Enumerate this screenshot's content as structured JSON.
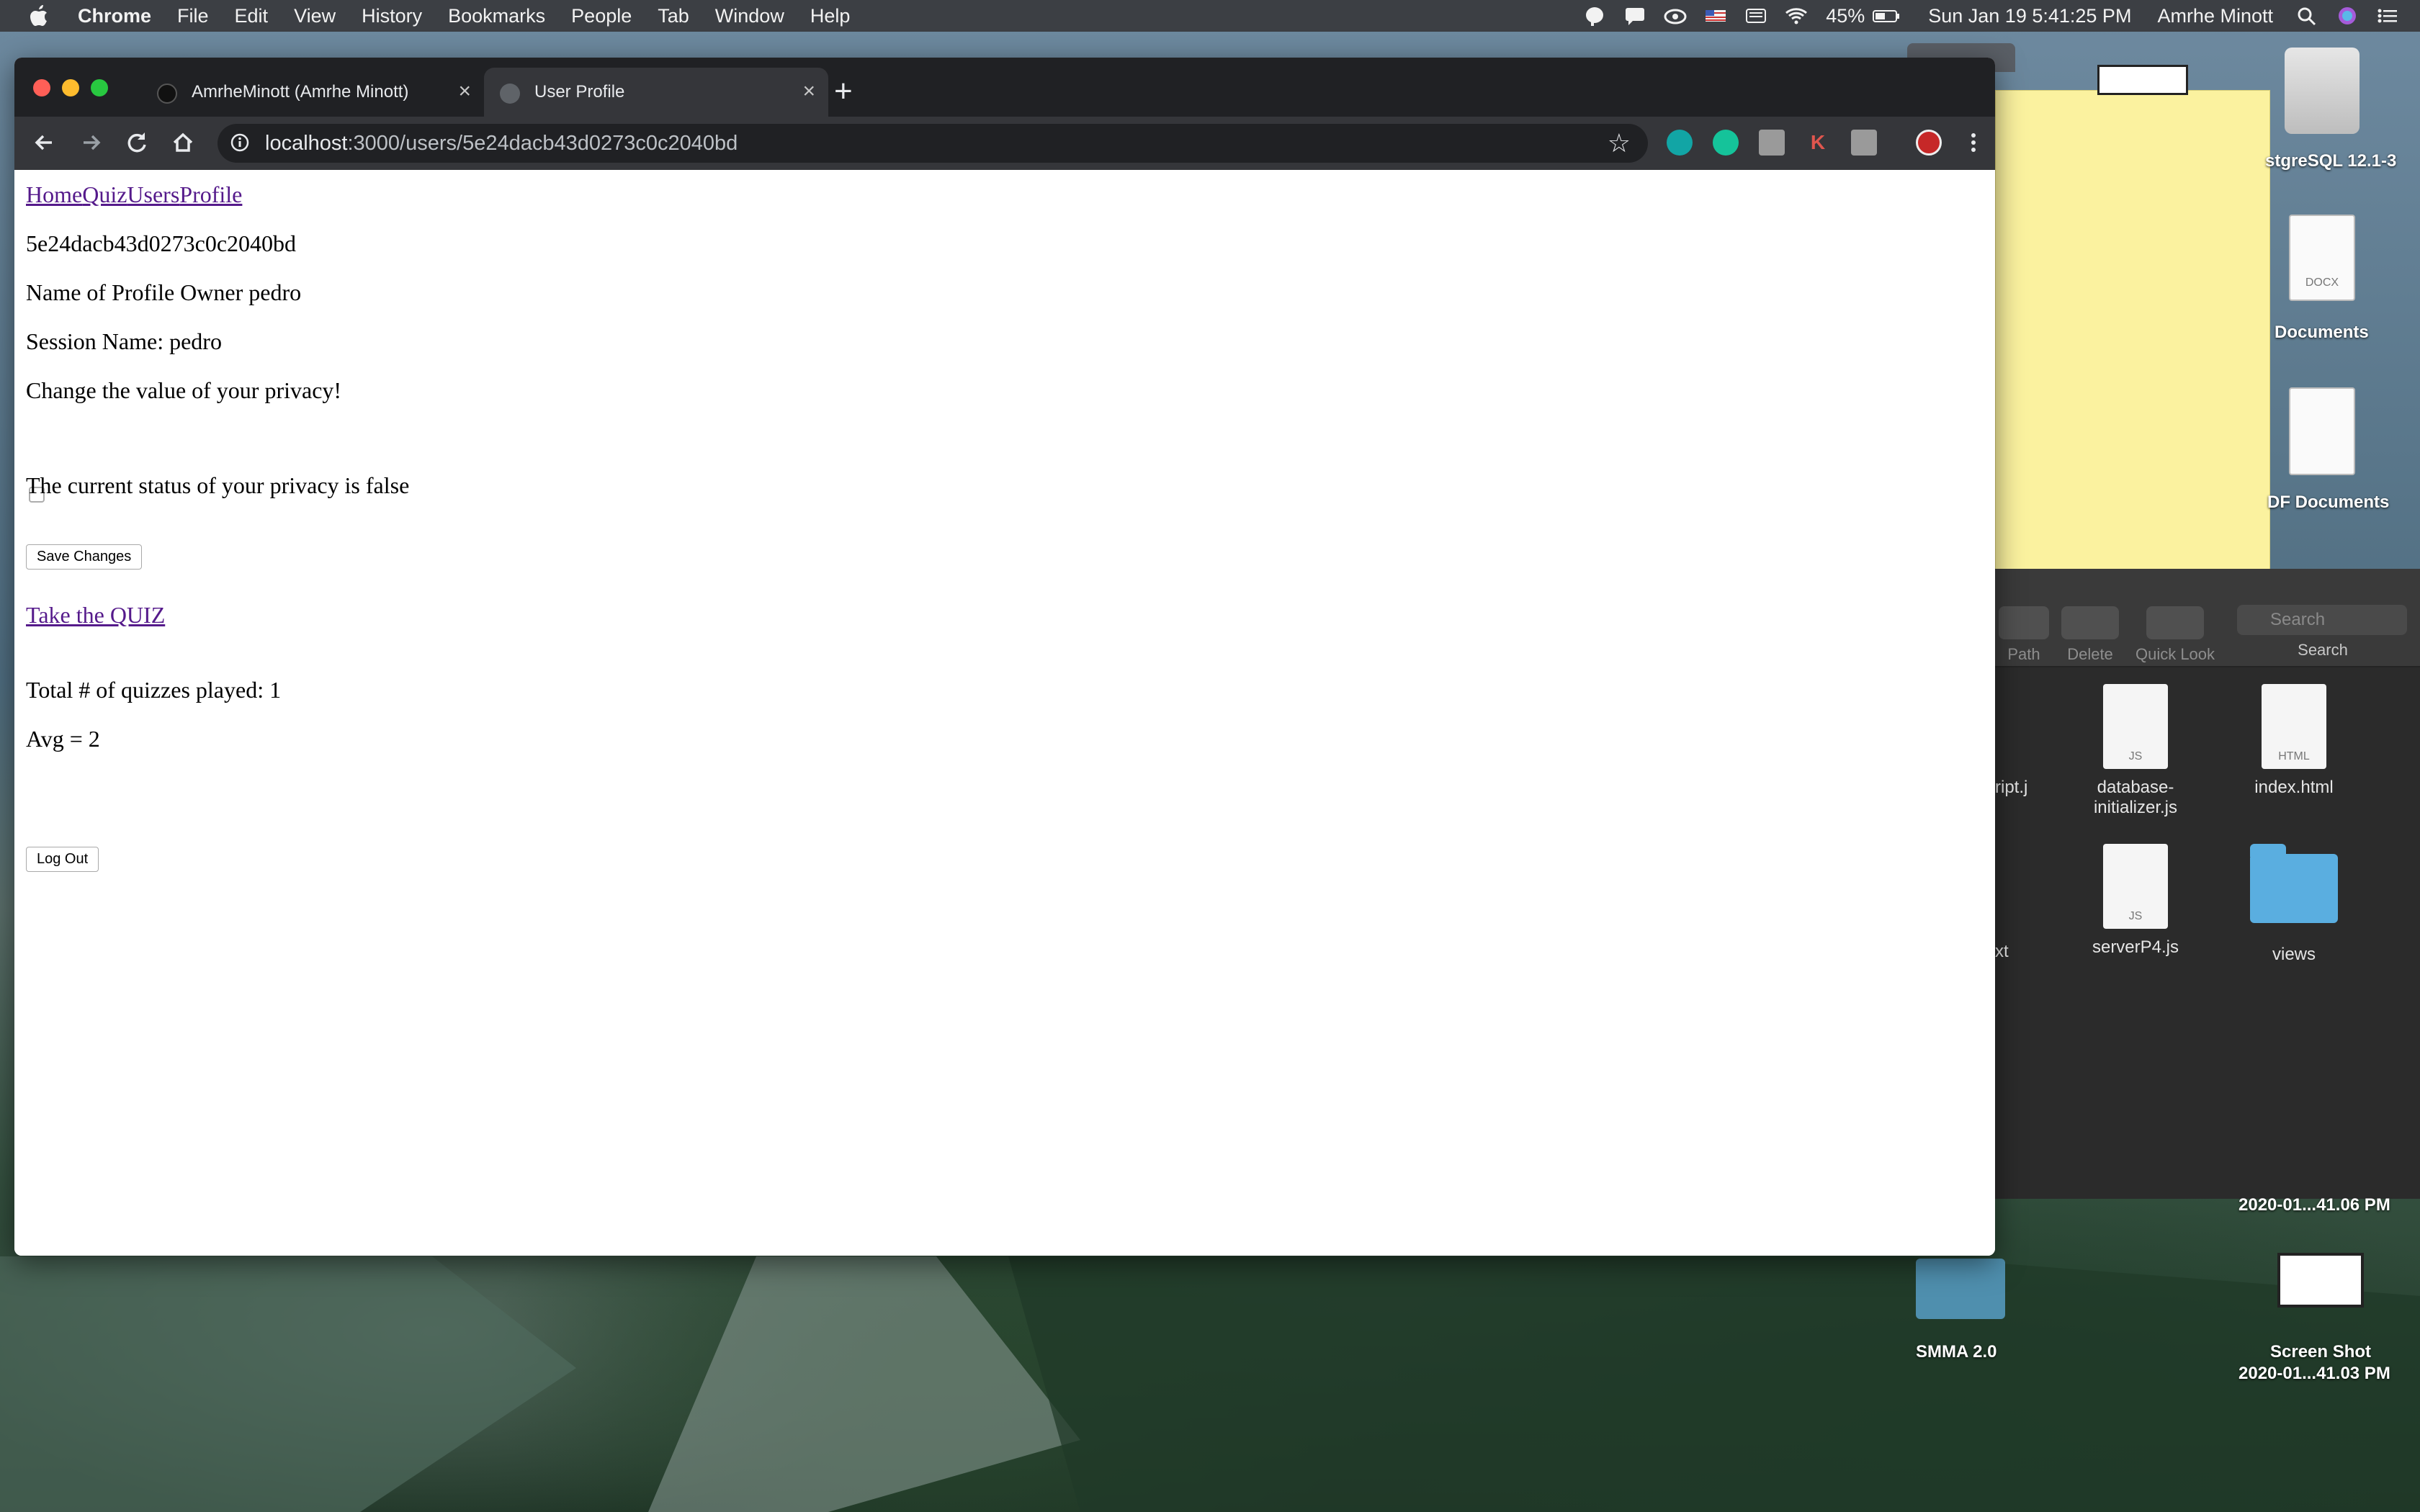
{
  "menubar": {
    "app_name": "Chrome",
    "menus": [
      "File",
      "Edit",
      "View",
      "History",
      "Bookmarks",
      "People",
      "Tab",
      "Window",
      "Help"
    ],
    "battery": "45%",
    "datetime": "Sun Jan 19  5:41:25 PM",
    "user": "Amrhe Minott"
  },
  "browser": {
    "tabs": [
      {
        "title": "AmrheMinott (Amrhe Minott)",
        "active": false
      },
      {
        "title": "User Profile",
        "active": true
      }
    ],
    "url_host": "localhost",
    "url_path": ":3000/users/5e24dacb43d0273c0c2040bd"
  },
  "page": {
    "nav_links": [
      "Home",
      "Quiz",
      "Users",
      "Profile"
    ],
    "user_id": "5e24dacb43d0273c0c2040bd",
    "profile_owner": "Name of Profile Owner pedro",
    "session_name": "Session Name: pedro",
    "privacy_prompt": "Change the value of your privacy!",
    "privacy_checked": false,
    "privacy_status": "The current status of your privacy is false",
    "save_button": "Save Changes",
    "quiz_link": "Take the QUIZ",
    "quizzes_played": "Total # of quizzes played: 1",
    "average": "Avg = 2",
    "logout_button": "Log Out"
  },
  "desktop": {
    "items": [
      {
        "label": "stgreSQL 12.1-3"
      },
      {
        "label": "Documents"
      },
      {
        "label": "DF Documents"
      },
      {
        "label": "2020-01...41.06 PM"
      },
      {
        "label": "SMMA 2.0"
      },
      {
        "label": "Screen Shot"
      },
      {
        "label": "2020-01...41.03 PM"
      }
    ],
    "doc_tag": "DOCX"
  },
  "finder": {
    "toolbar": [
      "Path",
      "Delete",
      "Quick Look"
    ],
    "search_placeholder": "Search",
    "search_label": "Search",
    "files": [
      {
        "name": "ript.j",
        "tag": ""
      },
      {
        "name": "database-\ninitializer.js",
        "tag": "JS"
      },
      {
        "name": "index.html",
        "tag": "HTML"
      },
      {
        "name": "xt",
        "tag": ""
      },
      {
        "name": "serverP4.js",
        "tag": "JS"
      },
      {
        "name": "views",
        "tag": ""
      }
    ]
  }
}
